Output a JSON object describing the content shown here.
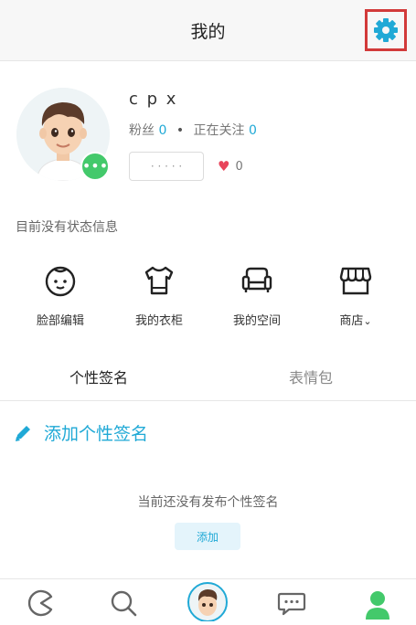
{
  "header": {
    "title": "我的",
    "settings_icon": "gear-icon"
  },
  "profile": {
    "username": "c p x",
    "fans_label": "粉丝",
    "fans_count": "0",
    "separator": "•",
    "following_label": "正在关注",
    "following_count": "0",
    "tag_text": "· · · · ·",
    "likes_count": "0",
    "badge_icon": "more-dots-icon"
  },
  "status_text": "目前没有状态信息",
  "quick_actions": [
    {
      "label": "脸部编辑",
      "icon": "face-icon"
    },
    {
      "label": "我的衣柜",
      "icon": "tshirt-icon"
    },
    {
      "label": "我的空间",
      "icon": "sofa-icon"
    },
    {
      "label": "商店",
      "icon": "store-icon",
      "suffix": "⌄"
    }
  ],
  "tabs": [
    {
      "label": "个性签名",
      "active": true
    },
    {
      "label": "表情包",
      "active": false
    }
  ],
  "signature": {
    "add_label": "添加个性签名",
    "empty_text": "当前还没有发布个性签名",
    "add_button": "添加"
  },
  "bottom_nav": [
    {
      "icon": "pacman-icon"
    },
    {
      "icon": "search-icon"
    },
    {
      "icon": "avatar-icon"
    },
    {
      "icon": "chat-icon"
    },
    {
      "icon": "person-icon"
    }
  ],
  "colors": {
    "accent": "#20a9d6",
    "green": "#43c96b",
    "heart": "#e8445a",
    "highlight": "#d23a3a"
  }
}
